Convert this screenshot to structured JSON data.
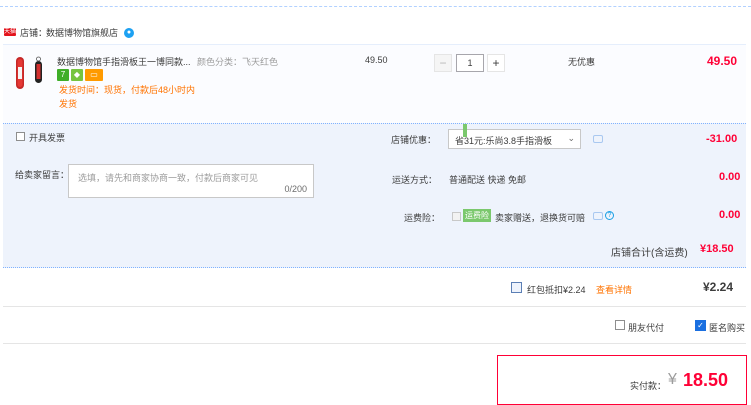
{
  "shop": {
    "badge": "天猫",
    "label": "店铺：",
    "name": "数据博物馆旗舰店"
  },
  "item": {
    "title": "数据博物馆手指滑板王一博同款...",
    "sku": "颜色分类：飞天红色",
    "shipping_note": "发货时间：现货，付款后48小时内发货",
    "unit_price": "49.50",
    "quantity": "1",
    "minus": "−",
    "plus": "+",
    "discount": "无优惠",
    "line_total": "49.50"
  },
  "options": {
    "invoice_label": "开具发票",
    "message_label": "给卖家留言：",
    "message_placeholder": "选填，请先和商家协商一致，付款后商家可见",
    "message_count": "0/200",
    "shop_promo_label": "店铺优惠：",
    "shop_promo_value": "省31元:乐尚3.8手指滑板",
    "shop_promo_amount": "-31.00",
    "delivery_label": "运送方式：",
    "delivery_value": "普通配送 快递 免邮",
    "delivery_amount": "0.00",
    "insurance_label": "运费险：",
    "insurance_tag": "运费险",
    "insurance_text": "卖家赠送，退换货可赔",
    "insurance_amount": "0.00"
  },
  "shop_total": {
    "label": "店铺合计(含运费)",
    "amount": "¥18.50"
  },
  "red_packet": {
    "label": "红包抵扣¥2.24",
    "link": "查看详情",
    "amount": "¥2.24"
  },
  "extras": {
    "friend_pay": "朋友代付",
    "anonymous": "匿名购买"
  },
  "pay": {
    "label": "实付款：",
    "currency": "¥",
    "amount": "18.50"
  },
  "colors": {
    "accent_red": "#ff0036",
    "accent_blue": "#1a9fe5",
    "panel_bg": "#eef3fc"
  }
}
